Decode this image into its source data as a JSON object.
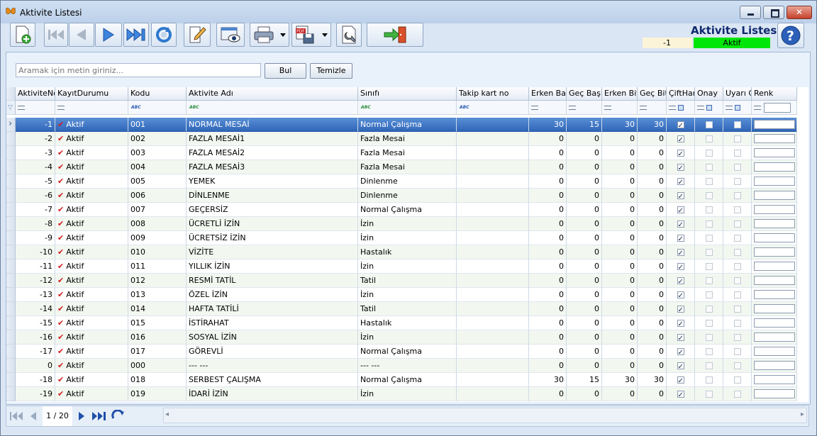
{
  "window": {
    "title": "Aktivite Listesi"
  },
  "header": {
    "title": "Aktivite Listesi",
    "record_no": "-1",
    "status": "Aktif",
    "status_color": "#00e60a"
  },
  "toolbar": {
    "icons": [
      "new-record-icon",
      "first-record-icon",
      "previous-record-icon",
      "next-record-icon",
      "last-record-icon",
      "refresh-icon",
      "edit-icon",
      "preview-icon",
      "print-icon",
      "pdf-export-icon",
      "settings-icon",
      "exit-icon",
      "help-icon"
    ]
  },
  "search": {
    "placeholder": "Aramak için metin giriniz...",
    "find_label": "Bul",
    "clear_label": "Temizle"
  },
  "grid": {
    "columns": [
      "AktiviteNo",
      "KayıtDurumu",
      "Kodu",
      "Aktivite Adı",
      "Sınıfı",
      "Takip kart no",
      "Erken Başl",
      "Geç Başla",
      "Erken Biti",
      "Geç Biti",
      "ÇiftHar",
      "Onay",
      "Uyarı G",
      "Renk"
    ],
    "rows": [
      {
        "no": "-1",
        "durum": "Aktif",
        "kodu": "001",
        "ad": "NORMAL MESAİ",
        "sinif": "Normal Çalışma",
        "takip": "",
        "eb": "30",
        "gb": "15",
        "ebt": "30",
        "gbt": "30",
        "cift": true,
        "onay": false,
        "uyari": false
      },
      {
        "no": "-2",
        "durum": "Aktif",
        "kodu": "002",
        "ad": "FAZLA MESAİ1",
        "sinif": "Fazla Mesai",
        "takip": "",
        "eb": "0",
        "gb": "0",
        "ebt": "0",
        "gbt": "0",
        "cift": true,
        "onay": false,
        "uyari": false
      },
      {
        "no": "-3",
        "durum": "Aktif",
        "kodu": "003",
        "ad": "FAZLA MESAİ2",
        "sinif": "Fazla Mesai",
        "takip": "",
        "eb": "0",
        "gb": "0",
        "ebt": "0",
        "gbt": "0",
        "cift": true,
        "onay": false,
        "uyari": false
      },
      {
        "no": "-4",
        "durum": "Aktif",
        "kodu": "004",
        "ad": "FAZLA MESAİ3",
        "sinif": "Fazla Mesai",
        "takip": "",
        "eb": "0",
        "gb": "0",
        "ebt": "0",
        "gbt": "0",
        "cift": true,
        "onay": false,
        "uyari": false
      },
      {
        "no": "-5",
        "durum": "Aktif",
        "kodu": "005",
        "ad": "YEMEK",
        "sinif": "Dinlenme",
        "takip": "",
        "eb": "0",
        "gb": "0",
        "ebt": "0",
        "gbt": "0",
        "cift": true,
        "onay": false,
        "uyari": false
      },
      {
        "no": "-6",
        "durum": "Aktif",
        "kodu": "006",
        "ad": "DİNLENME",
        "sinif": "Dinlenme",
        "takip": "",
        "eb": "0",
        "gb": "0",
        "ebt": "0",
        "gbt": "0",
        "cift": true,
        "onay": false,
        "uyari": false
      },
      {
        "no": "-7",
        "durum": "Aktif",
        "kodu": "007",
        "ad": "GEÇERSİZ",
        "sinif": "Normal Çalışma",
        "takip": "",
        "eb": "0",
        "gb": "0",
        "ebt": "0",
        "gbt": "0",
        "cift": true,
        "onay": false,
        "uyari": false
      },
      {
        "no": "-8",
        "durum": "Aktif",
        "kodu": "008",
        "ad": "ÜCRETLİ İZİN",
        "sinif": "İzin",
        "takip": "",
        "eb": "0",
        "gb": "0",
        "ebt": "0",
        "gbt": "0",
        "cift": true,
        "onay": false,
        "uyari": false
      },
      {
        "no": "-9",
        "durum": "Aktif",
        "kodu": "009",
        "ad": "ÜCRETSİZ İZİN",
        "sinif": "İzin",
        "takip": "",
        "eb": "0",
        "gb": "0",
        "ebt": "0",
        "gbt": "0",
        "cift": true,
        "onay": false,
        "uyari": false
      },
      {
        "no": "-10",
        "durum": "Aktif",
        "kodu": "010",
        "ad": "VİZİTE",
        "sinif": "Hastalık",
        "takip": "",
        "eb": "0",
        "gb": "0",
        "ebt": "0",
        "gbt": "0",
        "cift": true,
        "onay": false,
        "uyari": false
      },
      {
        "no": "-11",
        "durum": "Aktif",
        "kodu": "011",
        "ad": "YILLIK İZİN",
        "sinif": "İzin",
        "takip": "",
        "eb": "0",
        "gb": "0",
        "ebt": "0",
        "gbt": "0",
        "cift": true,
        "onay": false,
        "uyari": false
      },
      {
        "no": "-12",
        "durum": "Aktif",
        "kodu": "012",
        "ad": "RESMİ TATİL",
        "sinif": "Tatil",
        "takip": "",
        "eb": "0",
        "gb": "0",
        "ebt": "0",
        "gbt": "0",
        "cift": true,
        "onay": false,
        "uyari": false
      },
      {
        "no": "-13",
        "durum": "Aktif",
        "kodu": "013",
        "ad": "ÖZEL İZİN",
        "sinif": "İzin",
        "takip": "",
        "eb": "0",
        "gb": "0",
        "ebt": "0",
        "gbt": "0",
        "cift": true,
        "onay": false,
        "uyari": false
      },
      {
        "no": "-14",
        "durum": "Aktif",
        "kodu": "014",
        "ad": "HAFTA TATİLİ",
        "sinif": "Tatil",
        "takip": "",
        "eb": "0",
        "gb": "0",
        "ebt": "0",
        "gbt": "0",
        "cift": true,
        "onay": false,
        "uyari": false
      },
      {
        "no": "-15",
        "durum": "Aktif",
        "kodu": "015",
        "ad": "İSTİRAHAT",
        "sinif": "Hastalık",
        "takip": "",
        "eb": "0",
        "gb": "0",
        "ebt": "0",
        "gbt": "0",
        "cift": true,
        "onay": false,
        "uyari": false
      },
      {
        "no": "-16",
        "durum": "Aktif",
        "kodu": "016",
        "ad": "SOSYAL İZİN",
        "sinif": "İzin",
        "takip": "",
        "eb": "0",
        "gb": "0",
        "ebt": "0",
        "gbt": "0",
        "cift": true,
        "onay": false,
        "uyari": false
      },
      {
        "no": "-17",
        "durum": "Aktif",
        "kodu": "017",
        "ad": "GÖREVLİ",
        "sinif": "Normal Çalışma",
        "takip": "",
        "eb": "0",
        "gb": "0",
        "ebt": "0",
        "gbt": "0",
        "cift": true,
        "onay": false,
        "uyari": false
      },
      {
        "no": "0",
        "durum": "Aktif",
        "kodu": "000",
        "ad": "--- ---",
        "sinif": "--- ---",
        "takip": "",
        "eb": "0",
        "gb": "0",
        "ebt": "0",
        "gbt": "0",
        "cift": true,
        "onay": false,
        "uyari": false
      },
      {
        "no": "-18",
        "durum": "Aktif",
        "kodu": "018",
        "ad": "SERBEST ÇALIŞMA",
        "sinif": "Normal Çalışma",
        "takip": "",
        "eb": "30",
        "gb": "15",
        "ebt": "30",
        "gbt": "30",
        "cift": true,
        "onay": false,
        "uyari": false
      },
      {
        "no": "-19",
        "durum": "Aktif",
        "kodu": "019",
        "ad": "İDARİ İZİN",
        "sinif": "İzin",
        "takip": "",
        "eb": "0",
        "gb": "0",
        "ebt": "0",
        "gbt": "0",
        "cift": true,
        "onay": false,
        "uyari": false
      }
    ]
  },
  "pager": {
    "text": "1 / 20"
  }
}
